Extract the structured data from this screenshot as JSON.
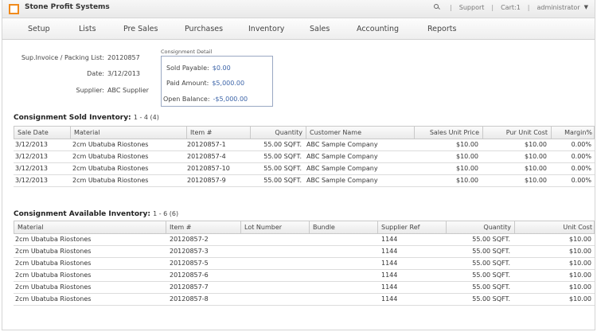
{
  "app": {
    "title": "Stone Profit Systems"
  },
  "topbar": {
    "support": "Support",
    "cart": "Cart:1",
    "user": "administrator"
  },
  "nav": [
    "Setup",
    "Lists",
    "Pre Sales",
    "Purchases",
    "Inventory",
    "Sales",
    "Accounting",
    "Reports"
  ],
  "header": {
    "invoice_label": "Sup.Invoice / Packing List:",
    "invoice_value": "20120857",
    "date_label": "Date:",
    "date_value": "3/12/2013",
    "supplier_label": "Supplier:",
    "supplier_value": "ABC Supplier"
  },
  "consignment": {
    "title": "Consignment Detail",
    "sold_payable_label": "Sold Payable:",
    "sold_payable": "$0.00",
    "paid_amount_label": "Paid Amount:",
    "paid_amount": "$5,000.00",
    "open_balance_label": "Open Balance:",
    "open_balance": "-$5,000.00"
  },
  "sold": {
    "title": "Consignment Sold Inventory:",
    "count": "1 - 4 (4)",
    "columns": [
      "Sale Date",
      "Material",
      "Item #",
      "Quantity",
      "Customer Name",
      "Sales Unit Price",
      "Pur Unit Cost",
      "Margin%"
    ],
    "rows": [
      [
        "3/12/2013",
        "2cm Ubatuba Riostones",
        "20120857-1",
        "55.00 SQFT.",
        "ABC Sample Company",
        "$10.00",
        "$10.00",
        "0.00%"
      ],
      [
        "3/12/2013",
        "2cm Ubatuba Riostones",
        "20120857-4",
        "55.00 SQFT.",
        "ABC Sample Company",
        "$10.00",
        "$10.00",
        "0.00%"
      ],
      [
        "3/12/2013",
        "2cm Ubatuba Riostones",
        "20120857-10",
        "55.00 SQFT.",
        "ABC Sample Company",
        "$10.00",
        "$10.00",
        "0.00%"
      ],
      [
        "3/12/2013",
        "2cm Ubatuba Riostones",
        "20120857-9",
        "55.00 SQFT.",
        "ABC Sample Company",
        "$10.00",
        "$10.00",
        "0.00%"
      ]
    ]
  },
  "available": {
    "title": "Consignment Available Inventory:",
    "count": "1 - 6 (6)",
    "columns": [
      "Material",
      "Item #",
      "Lot Number",
      "Bundle",
      "Supplier Ref",
      "Quantity",
      "Unit Cost"
    ],
    "rows": [
      [
        "2cm Ubatuba Riostones",
        "20120857-2",
        "",
        "",
        "1144",
        "55.00 SQFT.",
        "$10.00"
      ],
      [
        "2cm Ubatuba Riostones",
        "20120857-3",
        "",
        "",
        "1144",
        "55.00 SQFT.",
        "$10.00"
      ],
      [
        "2cm Ubatuba Riostones",
        "20120857-5",
        "",
        "",
        "1144",
        "55.00 SQFT.",
        "$10.00"
      ],
      [
        "2cm Ubatuba Riostones",
        "20120857-6",
        "",
        "",
        "1144",
        "55.00 SQFT.",
        "$10.00"
      ],
      [
        "2cm Ubatuba Riostones",
        "20120857-7",
        "",
        "",
        "1144",
        "55.00 SQFT.",
        "$10.00"
      ],
      [
        "2cm Ubatuba Riostones",
        "20120857-8",
        "",
        "",
        "1144",
        "55.00 SQFT.",
        "$10.00"
      ]
    ]
  },
  "colors": {
    "accent": "#f08a1c",
    "link": "#3c64a8"
  }
}
